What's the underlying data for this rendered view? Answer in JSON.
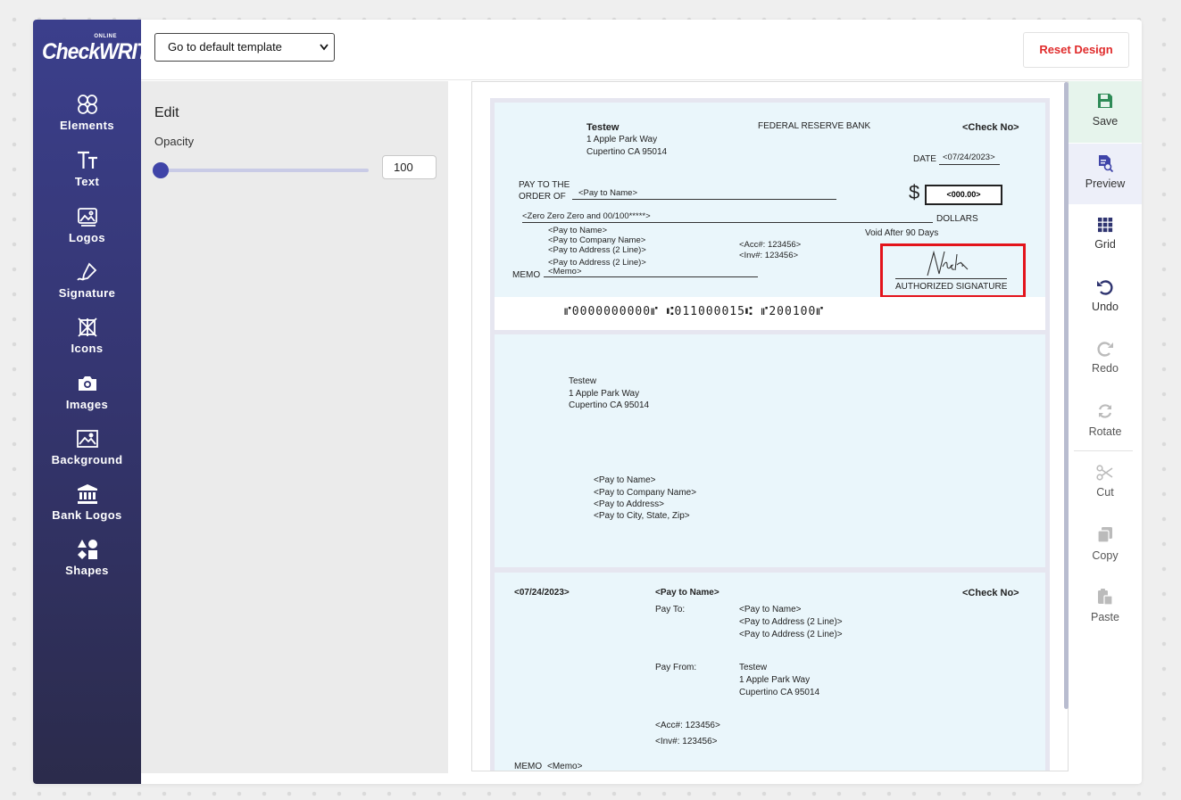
{
  "brand": {
    "small": "ONLINE",
    "main": "CheckWRITER"
  },
  "sidebar": {
    "items": [
      {
        "label": "Elements",
        "icon": "elements-icon"
      },
      {
        "label": "Text",
        "icon": "text-icon"
      },
      {
        "label": "Logos",
        "icon": "logos-icon"
      },
      {
        "label": "Signature",
        "icon": "signature-icon"
      },
      {
        "label": "Icons",
        "icon": "icons-icon"
      },
      {
        "label": "Images",
        "icon": "camera-icon"
      },
      {
        "label": "Background",
        "icon": "background-icon"
      },
      {
        "label": "Bank Logos",
        "icon": "bank-icon"
      },
      {
        "label": "Shapes",
        "icon": "shapes-icon"
      }
    ]
  },
  "topbar": {
    "template_select": "Go to default template",
    "reset_label": "Reset Design"
  },
  "edit": {
    "title": "Edit",
    "opacity_label": "Opacity",
    "opacity_value": "100",
    "opacity_fraction": 0.0
  },
  "check": {
    "top": {
      "name": "Testew",
      "address1": "1 Apple Park Way",
      "address2": "Cupertino CA 95014",
      "bank": "FEDERAL RESERVE BANK",
      "check_no": "<Check No>",
      "date_label": "DATE",
      "date": "<07/24/2023>",
      "pay_to_line1": "PAY TO THE",
      "pay_to_line2": "ORDER OF",
      "pay_to_name": "<Pay to Name>",
      "dollar_sign": "$",
      "amount": "<000.00>",
      "amount_words": "<Zero Zero Zero and 00/100*****>",
      "dollars": "DOLLARS",
      "void_after": "Void After 90 Days",
      "addr_name": "<Pay to Name>",
      "addr_company": "<Pay to Company Name>",
      "addr_line1": "<Pay to Address (2 Line)>",
      "addr_line2": "<Pay to Address (2 Line)>",
      "acc": "<Acc#: 123456>",
      "inv": "<Inv#: 123456>",
      "memo_label": "MEMO",
      "memo": "<Memo>",
      "auth_sig": "AUTHORIZED SIGNATURE",
      "micr": "⑈0000000000⑈  ⑆011000015⑆  ⑈200100⑈"
    },
    "middle": {
      "name": "Testew",
      "address1": "1 Apple Park Way",
      "address2": "Cupertino CA 95014",
      "to_name": "<Pay to Name>",
      "to_company": "<Pay to Company Name>",
      "to_address": "<Pay to Address>",
      "to_city": "<Pay to City, State, Zip>"
    },
    "bottom": {
      "date": "<07/24/2023>",
      "pay_to_name": "<Pay to Name>",
      "check_no": "<Check No>",
      "pay_to_label": "Pay To:",
      "pay_to_name2": "<Pay to Name>",
      "pay_to_addr1": "<Pay to Address (2 Line)>",
      "pay_to_addr2": "<Pay to Address (2 Line)>",
      "pay_from_label": "Pay From:",
      "from_name": "Testew",
      "from_addr1": "1 Apple Park Way",
      "from_addr2": "Cupertino CA 95014",
      "acc": "<Acc#: 123456>",
      "inv": "<Inv#: 123456>",
      "memo_label": "MEMO",
      "memo": "<Memo>"
    }
  },
  "rightbar": {
    "save": "Save",
    "preview": "Preview",
    "grid": "Grid",
    "undo": "Undo",
    "redo": "Redo",
    "rotate": "Rotate",
    "cut": "Cut",
    "copy": "Copy",
    "paste": "Paste"
  },
  "colors": {
    "sidebar_top": "#3b3f8c",
    "sidebar_bottom": "#2b2b4b",
    "accent": "#3f44a8",
    "reset_text": "#e02b2b",
    "save_icon": "#2e8b57",
    "highlight": "#e3131b",
    "check_bg": "#eaf6fb"
  }
}
